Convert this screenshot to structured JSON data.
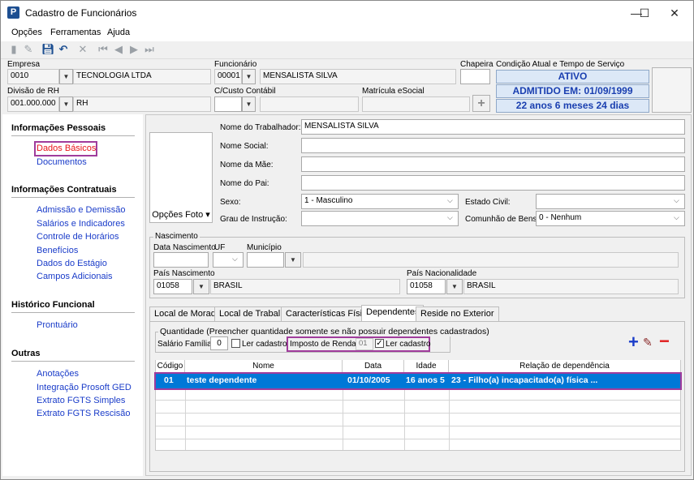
{
  "window": {
    "title": "Cadastro de Funcionários",
    "minimize": "—",
    "maximize": "☐",
    "close": "✕"
  },
  "menu": {
    "opcoes": "Opções",
    "ferramentas": "Ferramentas",
    "ajuda": "Ajuda"
  },
  "header": {
    "empresa_label": "Empresa",
    "empresa_code": "0010",
    "empresa_name": "TECNOLOGIA LTDA",
    "divisao_label": "Divisão de RH",
    "divisao_code": "001.000.000",
    "divisao_name": "RH",
    "funcionario_label": "Funcionário",
    "funcionario_code": "00001",
    "funcionario_name": "MENSALISTA SILVA",
    "ccusto_label": "C/Custo Contábil",
    "matricula_label": "Matrícula eSocial",
    "chapeira_label": "Chapeira",
    "condicao_label": "Condição Atual e Tempo de Serviço",
    "status_ativo": "ATIVO",
    "admitido": "ADMITIDO EM: 01/09/1999",
    "tempo": "22 anos 6 meses 24 dias"
  },
  "sidebar": {
    "sec1": "Informações Pessoais",
    "dados_basicos": "Dados Básicos",
    "documentos": "Documentos",
    "sec2": "Informações Contratuais",
    "admissao": "Admissão e Demissão",
    "salarios": "Salários e Indicadores",
    "controle": "Controle de Horários",
    "beneficios": "Benefícios",
    "estagio": "Dados do Estágio",
    "campos": "Campos Adicionais",
    "sec3": "Histórico Funcional",
    "prontuario": "Prontuário",
    "sec4": "Outras",
    "anotacoes": "Anotações",
    "integracao": "Integração Prosoft GED",
    "extrato_simples": "Extrato FGTS Simples",
    "extrato_rescisao": "Extrato FGTS Rescisão"
  },
  "form": {
    "opcoes_foto": "Opções Foto",
    "nome_trab_label": "Nome do Trabalhador:",
    "nome_trab": "MENSALISTA SILVA",
    "nome_social_label": "Nome Social:",
    "nome_mae_label": "Nome da Mãe:",
    "nome_pai_label": "Nome do Pai:",
    "sexo_label": "Sexo:",
    "sexo": "1 - Masculino",
    "estado_civil_label": "Estado Civil:",
    "grau_label": "Grau de Instrução:",
    "comunhao_label": "Comunhão de Bens:",
    "comunhao": "0 - Nenhum",
    "nascimento_group": "Nascimento",
    "data_nasc_label": "Data Nascimento",
    "uf_label": "UF",
    "municipio_label": "Município",
    "pais_nasc_label": "País Nascimento",
    "pais_nasc_code": "01058",
    "pais_nasc_name": "BRASIL",
    "pais_nac_label": "País Nacionalidade",
    "pais_nac_code": "01058",
    "pais_nac_name": "BRASIL"
  },
  "tabs": {
    "t1": "Local de Moradia",
    "t2": "Local de Trabalho",
    "t3": "Características Físicas",
    "t4": "Dependentes",
    "t5": "Reside no Exterior"
  },
  "dependentes": {
    "quantidade_group": "Quantidade (Preencher quantidade somente se não possuir dependentes cadastrados)",
    "salario_familia_label": "Salário Família",
    "salario_familia_value": "0",
    "ler_cadastro_1": "Ler cadastro",
    "imposto_label": "Imposto de Renda",
    "imposto_value": "01",
    "ler_cadastro_2": "Ler cadastro",
    "columns": [
      "Código",
      "Nome",
      "Data Nascimento",
      "Idade",
      "Relação de dependência"
    ],
    "row": {
      "codigo": "01",
      "nome": "teste dependente",
      "data": "01/10/2005",
      "idade": "16 anos 5",
      "relacao": "23 - Filho(a) incapacitado(a) física ..."
    }
  },
  "colors": {
    "accent": "#0078d7",
    "link": "#1a3cc9",
    "highlight": "#a03c9c",
    "selected_link": "#e8141a"
  }
}
